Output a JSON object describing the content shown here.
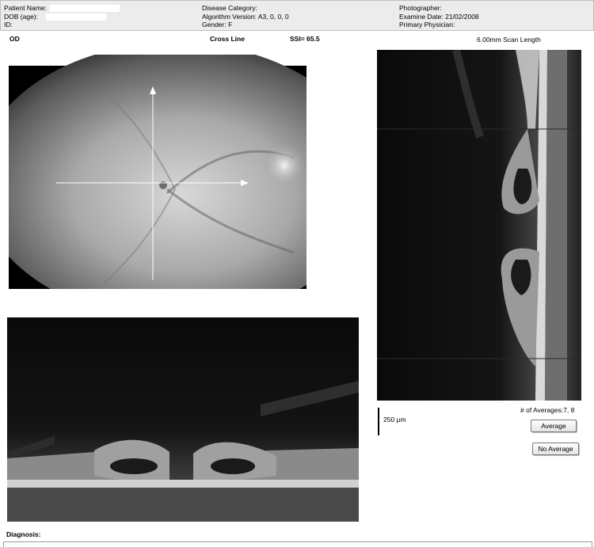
{
  "header": {
    "col1": {
      "patient_name": "Patient Name:",
      "dob": "DOB (age):",
      "id": "ID:"
    },
    "col2": {
      "disease_category": "Disease Category:",
      "algorithm_version": "Algorithm Version: A3, 0, 0, 0",
      "gender": "Gender: F"
    },
    "col3": {
      "photographer": "Photographer:",
      "examine_date": "Examine Date: 21/02/2008",
      "primary_physician": "Primary Physician:"
    }
  },
  "scan": {
    "eye": "OD",
    "pattern": "Cross Line",
    "ssi": "SSI= 65.5",
    "scan_length": "6.00mm Scan Length",
    "scale_bar_label": "250 µm",
    "averages": "# of Averages:7, 8"
  },
  "buttons": {
    "average": "Average",
    "no_average": "No Average"
  },
  "diagnosis_label": "Diagnosis:"
}
